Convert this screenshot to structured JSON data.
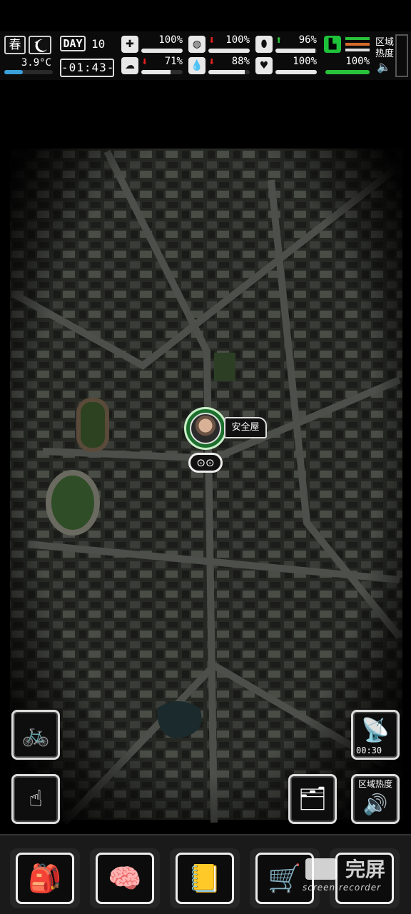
{
  "hud": {
    "season": "春",
    "temperature": "3.9°C",
    "day_label": "DAY",
    "day_number": "10",
    "clock": "-01:43-",
    "stats": [
      {
        "id": "health",
        "icon": "first-aid-icon",
        "value": "100%",
        "trend": "",
        "level": 1.0
      },
      {
        "id": "hunger",
        "icon": "stomach-icon",
        "value": "100%",
        "trend": "down",
        "level": 1.0
      },
      {
        "id": "supplies",
        "icon": "capsule-icon",
        "value": "96%",
        "trend": "up",
        "level": 0.96
      },
      {
        "id": "mental",
        "icon": "brain-icon",
        "value": "71%",
        "trend": "down",
        "level": 0.71
      },
      {
        "id": "thirst",
        "icon": "water-drop-icon",
        "value": "88%",
        "trend": "down",
        "level": 0.88
      },
      {
        "id": "mood",
        "icon": "heart-icon",
        "value": "100%",
        "trend": "",
        "level": 1.0
      }
    ],
    "stamina": {
      "value": "100%",
      "level": 1.0
    },
    "area_heat_label": "区域热度"
  },
  "map": {
    "safehouse_label": "安全屋"
  },
  "side_buttons": {
    "radio_timer": "00:30",
    "area_heat": "区域热度"
  },
  "watermark": {
    "title": "完屏",
    "subtitle": "screen recorder"
  }
}
